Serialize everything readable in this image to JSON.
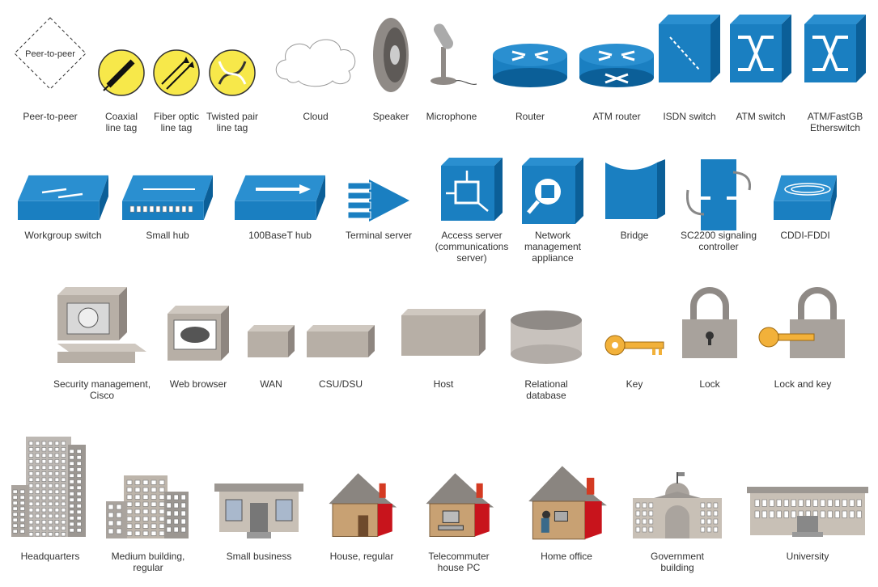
{
  "colors": {
    "blue": "#1a7fc1",
    "blue_dark": "#0b5f98",
    "yellow": "#f7e84a",
    "gray": "#bdb5ab",
    "gray_dark": "#8e8680"
  },
  "rows": [
    {
      "items": [
        {
          "label": "Peer-to-peer",
          "icon": "peer-to-peer-icon",
          "inner_text": "Peer-to-peer"
        },
        {
          "label": "Coaxial\nline tag",
          "icon": "coaxial-tag-icon"
        },
        {
          "label": "Fiber optic\nline tag",
          "icon": "fiber-tag-icon"
        },
        {
          "label": "Twisted pair\nline tag",
          "icon": "twisted-tag-icon"
        },
        {
          "label": "Cloud",
          "icon": "cloud-icon"
        },
        {
          "label": "Speaker",
          "icon": "speaker-icon"
        },
        {
          "label": "Microphone",
          "icon": "microphone-icon"
        },
        {
          "label": "Router",
          "icon": "router-icon"
        },
        {
          "label": "ATM router",
          "icon": "atm-router-icon"
        },
        {
          "label": "ISDN switch",
          "icon": "isdn-switch-icon"
        },
        {
          "label": "ATM switch",
          "icon": "atm-switch-icon"
        },
        {
          "label": "ATM/FastGB\nEtherswitch",
          "icon": "atm-fastgb-etherswitch-icon"
        }
      ]
    },
    {
      "items": [
        {
          "label": "Workgroup switch",
          "icon": "workgroup-switch-icon"
        },
        {
          "label": "Small hub",
          "icon": "small-hub-icon"
        },
        {
          "label": "100BaseT hub",
          "icon": "100baset-hub-icon"
        },
        {
          "label": "Terminal server",
          "icon": "terminal-server-icon"
        },
        {
          "label": "Access server\n(communications\nserver)",
          "icon": "access-server-icon"
        },
        {
          "label": "Network\nmanagement\nappliance",
          "icon": "network-management-icon"
        },
        {
          "label": "Bridge",
          "icon": "bridge-icon"
        },
        {
          "label": "SC2200 signaling\ncontroller",
          "icon": "sc2200-controller-icon"
        },
        {
          "label": "CDDI-FDDI",
          "icon": "cddi-fddi-icon"
        }
      ]
    },
    {
      "items": [
        {
          "label": "Security management,\nCisco",
          "icon": "security-management-icon"
        },
        {
          "label": "Web browser",
          "icon": "web-browser-icon"
        },
        {
          "label": "WAN",
          "icon": "wan-icon"
        },
        {
          "label": "CSU/DSU",
          "icon": "csu-dsu-icon"
        },
        {
          "label": "Host",
          "icon": "host-icon"
        },
        {
          "label": "Relational\ndatabase",
          "icon": "relational-database-icon"
        },
        {
          "label": "Key",
          "icon": "key-icon"
        },
        {
          "label": "Lock",
          "icon": "lock-icon"
        },
        {
          "label": "Lock and key",
          "icon": "lock-and-key-icon"
        }
      ]
    },
    {
      "items": [
        {
          "label": "Headquarters",
          "icon": "headquarters-icon"
        },
        {
          "label": "Medium building,\nregular",
          "icon": "medium-building-icon"
        },
        {
          "label": "Small business",
          "icon": "small-business-icon"
        },
        {
          "label": "House, regular",
          "icon": "house-icon"
        },
        {
          "label": "Telecommuter\nhouse PC",
          "icon": "telecommuter-house-icon"
        },
        {
          "label": "Home office",
          "icon": "home-office-icon"
        },
        {
          "label": "Government\nbuilding",
          "icon": "government-building-icon"
        },
        {
          "label": "University",
          "icon": "university-icon"
        }
      ]
    }
  ]
}
